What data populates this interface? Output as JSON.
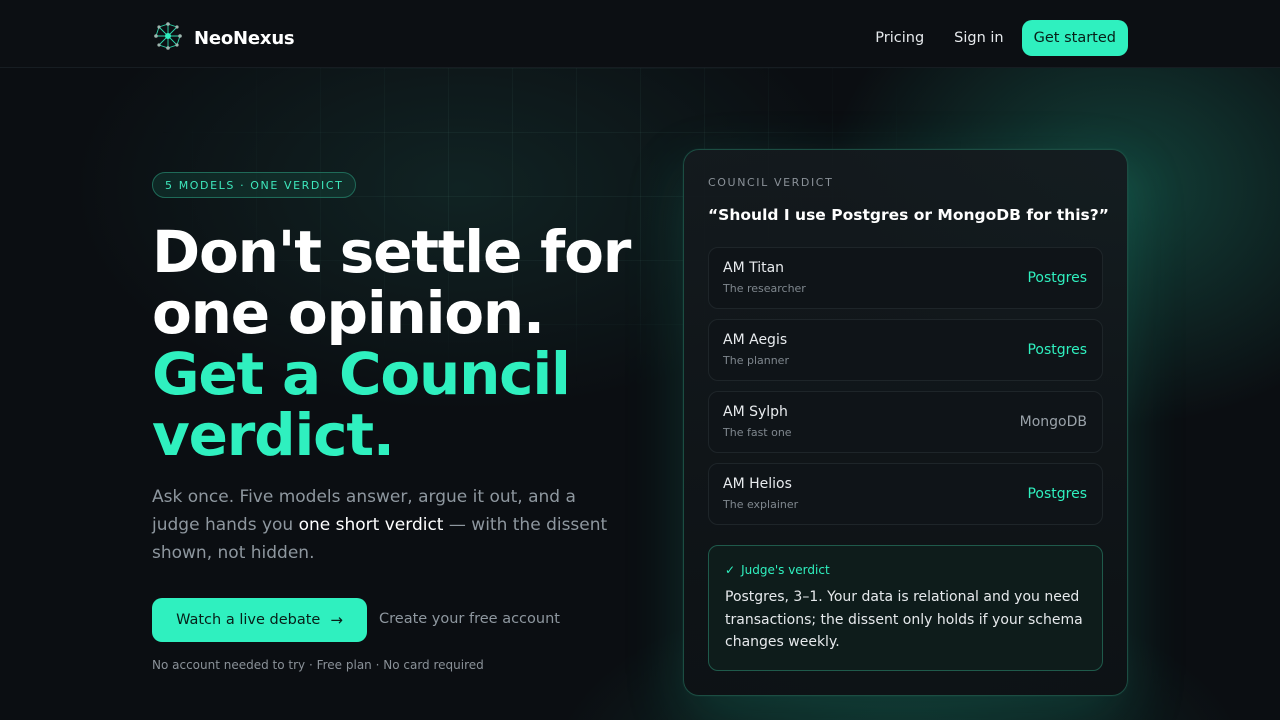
{
  "nav": {
    "brand": "NeoNexus",
    "links": [
      "Pricing",
      "Sign in"
    ],
    "cta": "Get started"
  },
  "hero": {
    "pill": "5 MODELS · ONE VERDICT",
    "headline_line1": "Don't settle for",
    "headline_line2": "one opinion.",
    "headline_accent1": "Get a Council",
    "headline_accent2": "verdict.",
    "sub_before": "Ask once. Five models answer, argue it out, and a judge hands you ",
    "sub_highlight": "one short verdict",
    "sub_after": " — with the dissent shown, not hidden.",
    "primary_button": "Watch a live debate",
    "secondary_link": "Create your free account",
    "fineprint": "No account needed to try · Free plan · No card required"
  },
  "card": {
    "eyebrow": "COUNCIL VERDICT",
    "question": "“Should I use Postgres or MongoDB for this?”",
    "models": [
      {
        "name": "AM Titan",
        "role": "The researcher",
        "vote": "Postgres",
        "agrees": true
      },
      {
        "name": "AM Aegis",
        "role": "The planner",
        "vote": "Postgres",
        "agrees": true
      },
      {
        "name": "AM Sylph",
        "role": "The fast one",
        "vote": "MongoDB",
        "agrees": false
      },
      {
        "name": "AM Helios",
        "role": "The explainer",
        "vote": "Postgres",
        "agrees": true
      }
    ],
    "judge_label": "Judge's verdict",
    "judge_text": "Postgres, 3–1. Your data is relational and you need transactions; the dissent only holds if your schema changes weekly."
  },
  "colors": {
    "accent": "#2ff0bf",
    "background": "#0b0e12",
    "muted": "#8e979f"
  },
  "icons": {
    "logo": "neural-network-icon",
    "arrow": "arrow-right-icon",
    "check": "check-icon"
  }
}
